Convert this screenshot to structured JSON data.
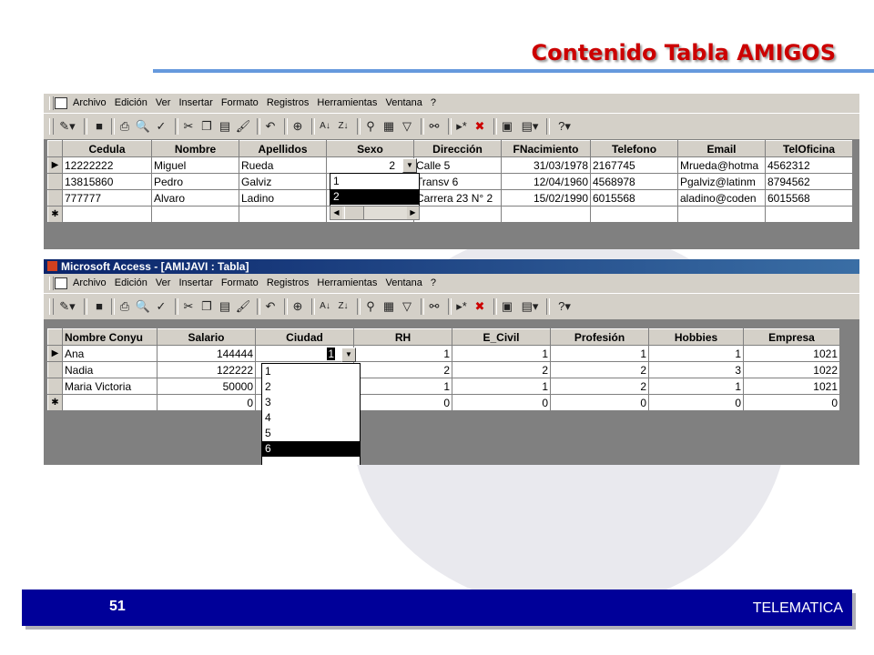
{
  "slide": {
    "title": "Contenido Tabla AMIGOS",
    "page_number": "51",
    "footer_label": "TELEMATICA"
  },
  "menus": [
    "Archivo",
    "Edición",
    "Ver",
    "Insertar",
    "Formato",
    "Registros",
    "Herramientas",
    "Ventana",
    "?"
  ],
  "window2_title": "Microsoft Access - [AMIJAVI : Tabla]",
  "table1": {
    "columns": [
      "Cedula",
      "Nombre",
      "Apellidos",
      "Sexo",
      "Dirección",
      "FNacimiento",
      "Telefono",
      "Email",
      "TelOficina"
    ],
    "rows": [
      [
        "12222222",
        "Miguel",
        "Rueda",
        "2",
        "Calle 5",
        "31/03/1978",
        "2167745",
        "Mrueda@hotma",
        "4562312"
      ],
      [
        "13815860",
        "Pedro",
        "Galviz",
        "",
        "Transv 6",
        "12/04/1960",
        "4568978",
        "Pgalviz@latinm",
        "8794562"
      ],
      [
        "777777",
        "Alvaro",
        "Ladino",
        "",
        "Carrera 23 N° 2",
        "15/02/1990",
        "6015568",
        "aladino@coden",
        "6015568"
      ]
    ],
    "dropdown_options": [
      "1",
      "2"
    ]
  },
  "table2": {
    "columns": [
      "Nombre Conyu",
      "Salario",
      "Ciudad",
      "RH",
      "E_Civil",
      "Profesión",
      "Hobbies",
      "Empresa"
    ],
    "rows": [
      [
        "Ana",
        "144444",
        "1",
        "1",
        "1",
        "1",
        "1",
        "1021"
      ],
      [
        "Nadia",
        "122222",
        "",
        "2",
        "2",
        "2",
        "3",
        "1022"
      ],
      [
        "Maria Victoria",
        "50000",
        "",
        "1",
        "1",
        "2",
        "1",
        "1021"
      ],
      [
        "",
        "0",
        "",
        "0",
        "0",
        "0",
        "0",
        "0"
      ]
    ],
    "dropdown_options": [
      "1",
      "2",
      "3",
      "4",
      "5",
      "6"
    ]
  }
}
